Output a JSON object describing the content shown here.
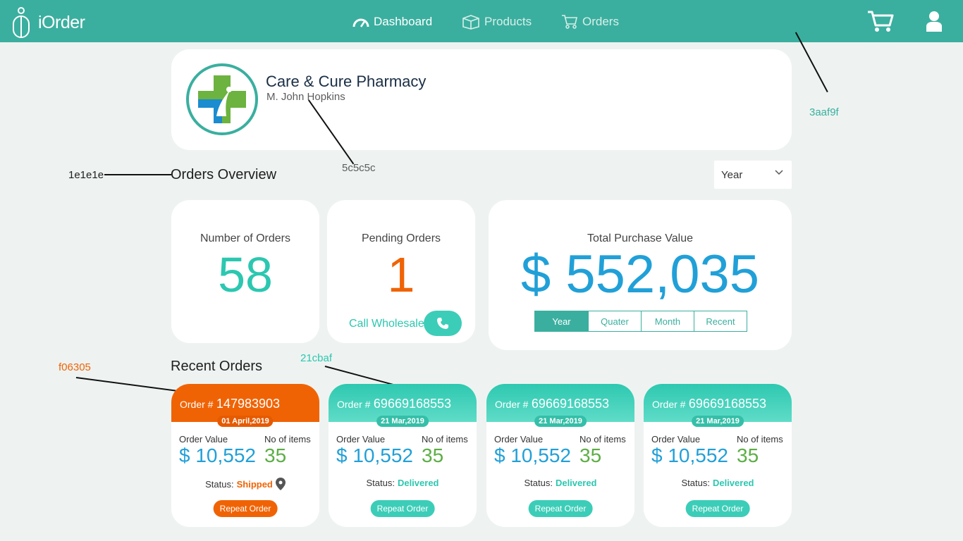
{
  "app": {
    "name": "iOrder"
  },
  "nav": {
    "dashboard": "Dashboard",
    "products": "Products",
    "orders": "Orders"
  },
  "profile": {
    "pharmacy": "Care & Cure Pharmacy",
    "owner": "M. John Hopkins"
  },
  "annotations": {
    "header_color": "3aaf9f",
    "owner_color": "5c5c5c",
    "title_color": "1e1e1e",
    "orange_color": "f06305",
    "blue_color": "21cbaf"
  },
  "overview": {
    "title": "Orders Overview",
    "period_select": "Year",
    "number_of_orders_label": "Number of Orders",
    "number_of_orders": "58",
    "pending_label": "Pending Orders",
    "pending": "1",
    "call_label": "Call Wholesaler",
    "total_label": "Total Purchase Value",
    "total_value": "$ 552,035",
    "periods": [
      "Year",
      "Quater",
      "Month",
      "Recent"
    ]
  },
  "recent": {
    "title": "Recent Orders",
    "order_prefix": "Order #",
    "value_label": "Order Value",
    "items_label": "No of items",
    "status_label": "Status:",
    "repeat_label": "Repeat Order",
    "orders": [
      {
        "number": "147983903",
        "date": "01 April,2019",
        "value": "$ 10,552",
        "items": "35",
        "status": "Shipped"
      },
      {
        "number": "69669168553",
        "date": "21 Mar,2019",
        "value": "$ 10,552",
        "items": "35",
        "status": "Delivered"
      },
      {
        "number": "69669168553",
        "date": "21 Mar,2019",
        "value": "$ 10,552",
        "items": "35",
        "status": "Delivered"
      },
      {
        "number": "69669168553",
        "date": "21 Mar,2019",
        "value": "$ 10,552",
        "items": "35",
        "status": "Delivered"
      }
    ]
  },
  "colors": {
    "header": "#3aaf9f",
    "orange": "#f06305",
    "teal": "#2cc7b0",
    "blue": "#21a0d8",
    "green": "#5cae45"
  },
  "icons": {
    "logo": "pharmacy-bottle-icon",
    "dashboard": "speedometer-icon",
    "products": "box-icon",
    "orders": "cart-icon",
    "cart": "shopping-cart-icon",
    "user": "user-icon",
    "call": "phone-icon",
    "location": "map-pin-icon"
  }
}
